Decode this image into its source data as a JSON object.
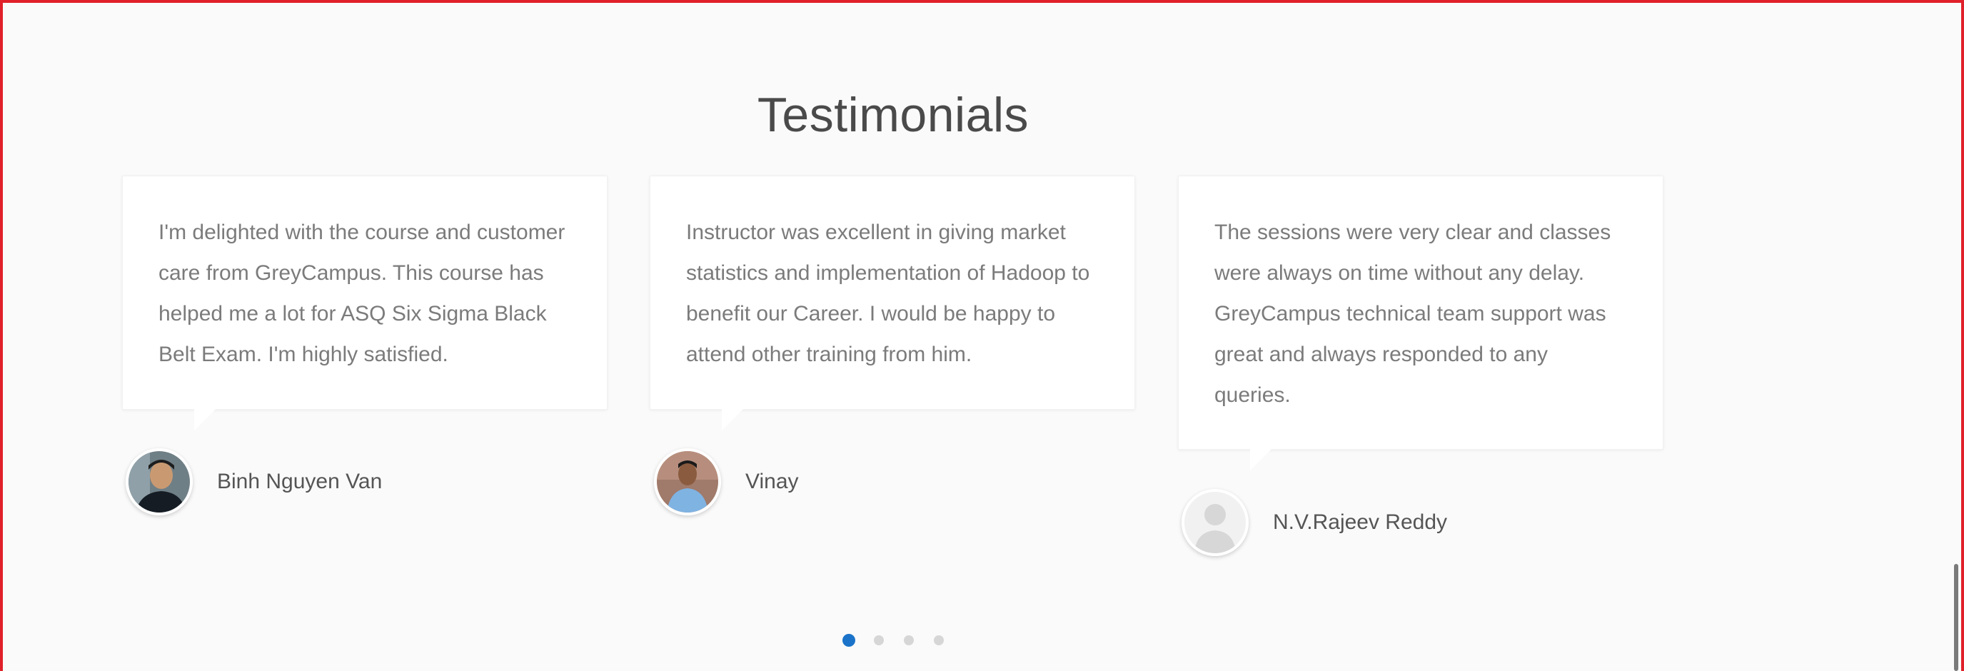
{
  "section": {
    "title": "Testimonials"
  },
  "testimonials": [
    {
      "quote": "I'm delighted with the course and customer care from GreyCampus. This course has helped me a lot for ASQ Six Sigma Black Belt Exam. I'm highly satisfied.",
      "author": "Binh Nguyen Van",
      "avatar_icon": "person-photo-icon"
    },
    {
      "quote": "Instructor was excellent in giving market statistics and implementation of Hadoop to benefit our Career. I would be happy to attend other training from him.",
      "author": "Vinay",
      "avatar_icon": "person-photo-icon"
    },
    {
      "quote": "The sessions were very clear and classes were always on time without any delay. GreyCampus technical team support was great and always responded to any queries.",
      "author": "N.V.Rajeev Reddy",
      "avatar_icon": "default-user-icon"
    }
  ],
  "carousel": {
    "active_index": 0,
    "total_pages": 4,
    "active_color": "#1a73c9",
    "inactive_color": "#d6d6d6"
  },
  "colors": {
    "frame": "#e0202a",
    "background": "#fafafa",
    "title": "#4a4a4a",
    "quote_text": "#7b7b7b"
  }
}
